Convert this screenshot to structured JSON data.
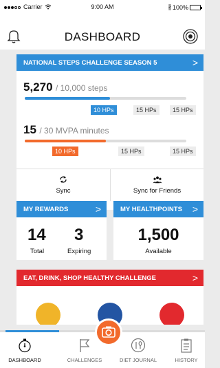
{
  "status_bar": {
    "carrier": "Carrier",
    "time": "9:00 AM",
    "battery": "100%"
  },
  "header": {
    "title": "DASHBOARD",
    "left_icon": "bell-icon",
    "right_icon": "radar-icon"
  },
  "steps_challenge": {
    "banner": "NATIONAL STEPS CHALLENGE SEASON 5",
    "steps": {
      "value": "5,270",
      "target": "/ 10,000 steps",
      "progress": 0.527,
      "tags": [
        "10 HPs",
        "15 HPs",
        "15 HPs"
      ]
    },
    "mvpa": {
      "value": "15",
      "target": "/ 30 MVPA minutes",
      "progress": 0.5,
      "tags": [
        "10 HPs",
        "15 HPs",
        "15 HPs"
      ]
    },
    "sync_label": "Sync",
    "sync_friends_label": "Sync for Friends"
  },
  "rewards": {
    "banner": "MY REWARDS",
    "total_value": "14",
    "total_label": "Total",
    "expiring_value": "3",
    "expiring_label": "Expiring"
  },
  "healthpoints": {
    "banner": "MY HEALTHPOINTS",
    "value": "1,500",
    "label": "Available"
  },
  "eat_challenge": {
    "banner": "EAT, DRINK, SHOP HEALTHY CHALLENGE"
  },
  "tabs": [
    {
      "label": "DASHBOARD",
      "icon": "stopwatch-icon"
    },
    {
      "label": "CHALLENGES",
      "icon": "flag-icon"
    },
    {
      "label": "DIET JOURNAL",
      "icon": "fork-spoon-icon"
    },
    {
      "label": "HISTORY",
      "icon": "clipboard-icon"
    }
  ],
  "colors": {
    "accent_blue": "#2f8ed8",
    "accent_orange": "#f26a2c",
    "accent_red": "#e2292e"
  }
}
